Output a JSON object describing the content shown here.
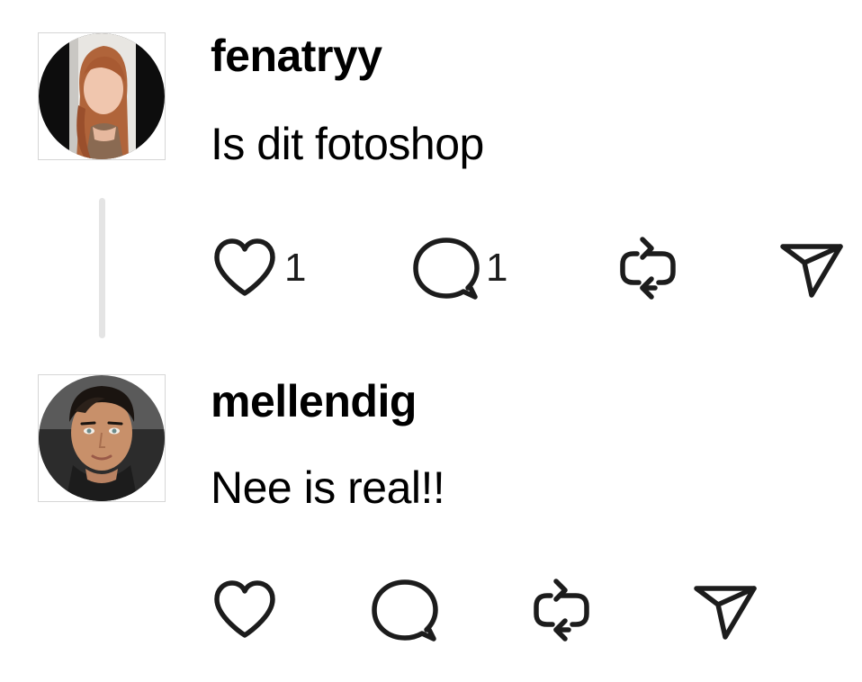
{
  "thread": [
    {
      "username": "fenatryy",
      "text": "Is dit fotoshop",
      "likes": "1",
      "replies": "1",
      "has_reply_thread": true,
      "avatar_description": "woman-with-long-reddish-hair"
    },
    {
      "username": "mellendig",
      "text": "Nee is real!!",
      "likes": "",
      "replies": "",
      "has_reply_thread": false,
      "avatar_description": "man-with-dark-styled-hair"
    }
  ],
  "icons": {
    "like": "heart-icon",
    "reply": "speech-bubble-icon",
    "repost": "repost-arrows-icon",
    "share": "paper-plane-icon"
  },
  "colors": {
    "icon_stroke": "#1c1c1c",
    "thread_line": "#e4e4e4",
    "avatar_border": "#d6d6d6"
  }
}
